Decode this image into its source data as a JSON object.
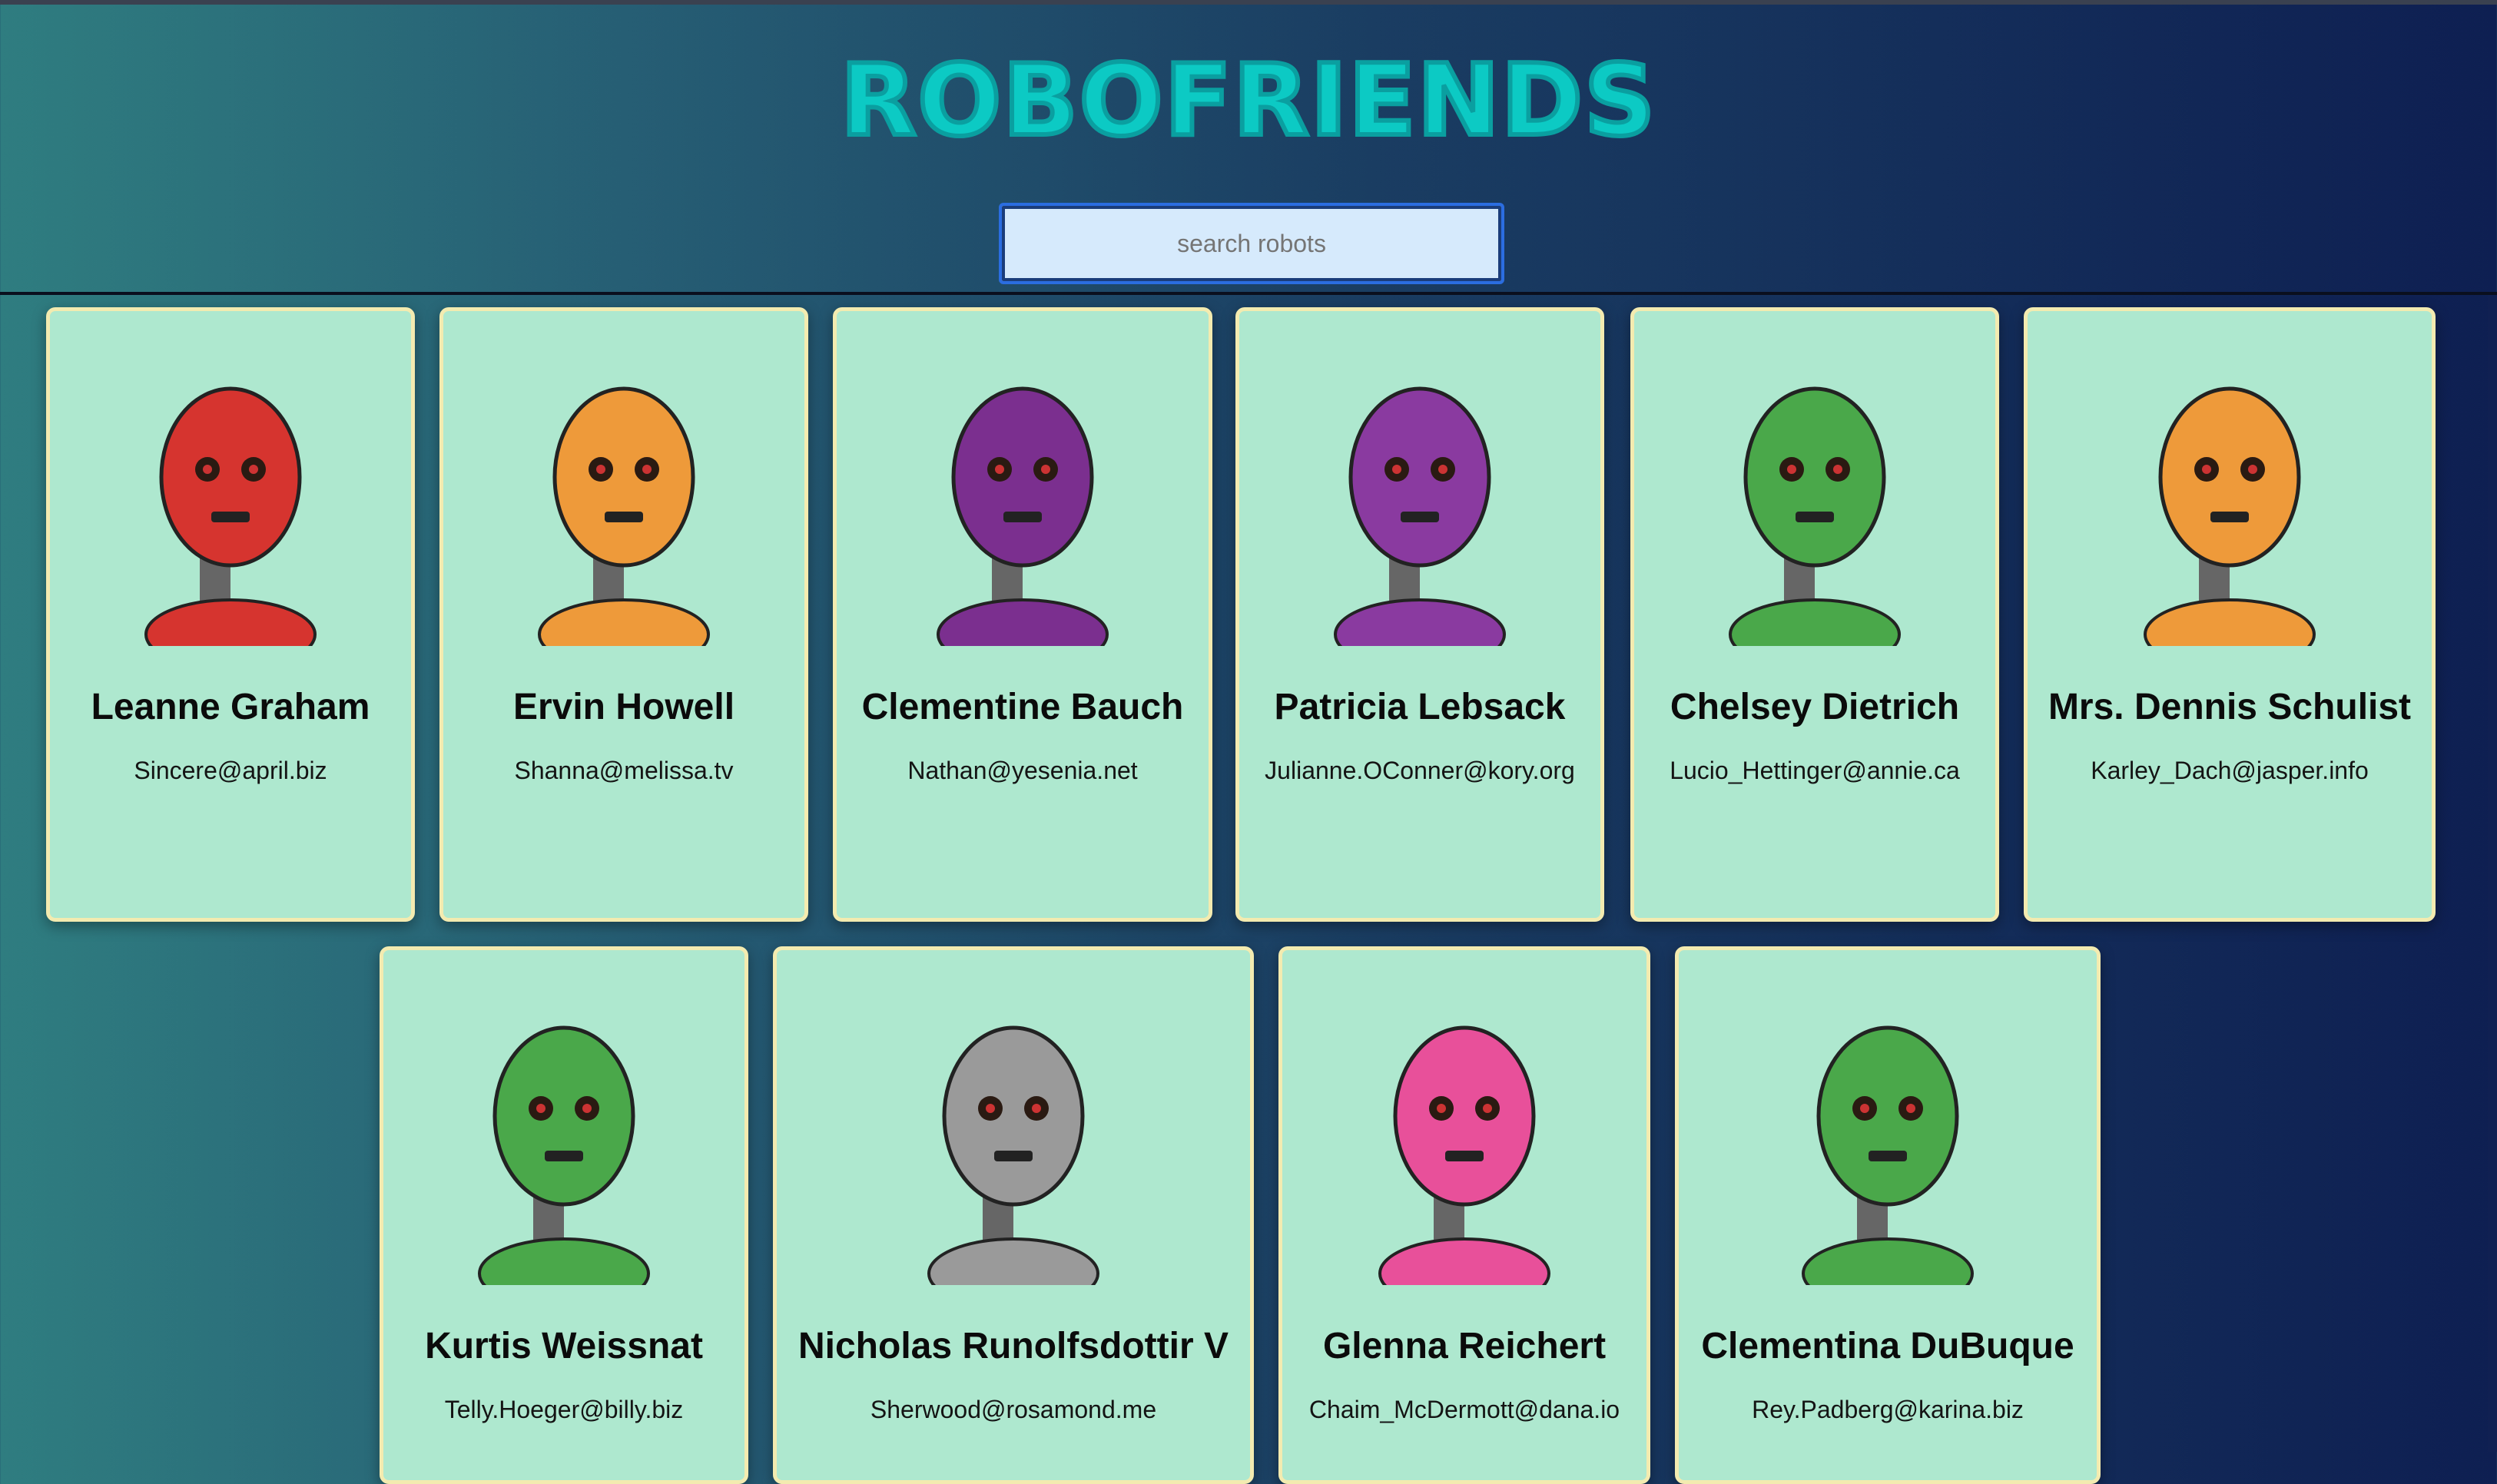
{
  "app": {
    "title": "ROBOFRIENDS"
  },
  "search": {
    "placeholder": "search robots"
  },
  "colors": {
    "accent": "#0ccac4",
    "card_bg": "#aee8cf",
    "card_border": "#f3ebb0"
  },
  "robots": [
    {
      "name": "Leanne Graham",
      "email": "Sincere@april.biz",
      "color": "#d6342f"
    },
    {
      "name": "Ervin Howell",
      "email": "Shanna@melissa.tv",
      "color": "#ee9a3a"
    },
    {
      "name": "Clementine Bauch",
      "email": "Nathan@yesenia.net",
      "color": "#7b2f8f"
    },
    {
      "name": "Patricia Lebsack",
      "email": "Julianne.OConner@kory.org",
      "color": "#8a3aa0"
    },
    {
      "name": "Chelsey Dietrich",
      "email": "Lucio_Hettinger@annie.ca",
      "color": "#4aa84a"
    },
    {
      "name": "Mrs. Dennis Schulist",
      "email": "Karley_Dach@jasper.info",
      "color": "#ee9a3a"
    },
    {
      "name": "Kurtis Weissnat",
      "email": "Telly.Hoeger@billy.biz",
      "color": "#4aa84a"
    },
    {
      "name": "Nicholas Runolfsdottir V",
      "email": "Sherwood@rosamond.me",
      "color": "#9a9a9a"
    },
    {
      "name": "Glenna Reichert",
      "email": "Chaim_McDermott@dana.io",
      "color": "#e8509a"
    },
    {
      "name": "Clementina DuBuque",
      "email": "Rey.Padberg@karina.biz",
      "color": "#4aa84a"
    }
  ]
}
